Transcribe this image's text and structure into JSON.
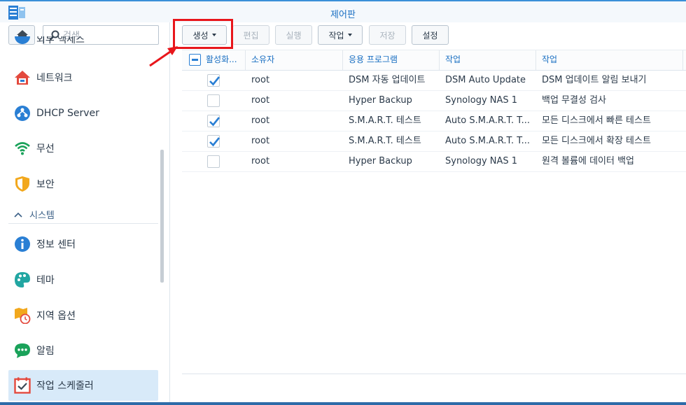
{
  "window": {
    "title": "제어판"
  },
  "colors": {
    "accent": "#1a6fc2",
    "highlight": "#e8161b",
    "active_bg": "#d8eaf9"
  },
  "sidebar": {
    "search_placeholder": "검색",
    "partial_item": "외부 액세스",
    "items": [
      {
        "label": "네트워크",
        "icon": "network-house-icon"
      },
      {
        "label": "DHCP Server",
        "icon": "dhcp-server-icon"
      },
      {
        "label": "무선",
        "icon": "wifi-icon"
      },
      {
        "label": "보안",
        "icon": "shield-icon"
      }
    ],
    "section": {
      "label": "시스템",
      "icon": "chevron-up-icon"
    },
    "system_items": [
      {
        "label": "정보 센터",
        "icon": "info-icon"
      },
      {
        "label": "테마",
        "icon": "palette-icon"
      },
      {
        "label": "지역 옵션",
        "icon": "map-clock-icon"
      },
      {
        "label": "알림",
        "icon": "chat-bubble-icon"
      },
      {
        "label": "작업 스케줄러",
        "icon": "calendar-check-icon",
        "active": true
      }
    ]
  },
  "toolbar": {
    "create": "생성",
    "edit": "편집",
    "run": "실행",
    "action": "작업",
    "save": "저장",
    "settings": "설정"
  },
  "table": {
    "columns": [
      "활성화...",
      "소유자",
      "응용 프로그램",
      "작업",
      "작업"
    ],
    "rows": [
      {
        "enabled": true,
        "owner": "root",
        "app": "DSM 자동 업데이트",
        "task": "DSM Auto Update",
        "action": "DSM 업데이트 알림 보내기"
      },
      {
        "enabled": false,
        "owner": "root",
        "app": "Hyper Backup",
        "task": "Synology NAS 1",
        "action": "백업 무결성 검사"
      },
      {
        "enabled": true,
        "owner": "root",
        "app": "S.M.A.R.T. 테스트",
        "task": "Auto S.M.A.R.T. T...",
        "action": "모든 디스크에서 빠른 테스트"
      },
      {
        "enabled": true,
        "owner": "root",
        "app": "S.M.A.R.T. 테스트",
        "task": "Auto S.M.A.R.T. T...",
        "action": "모든 디스크에서 확장 테스트"
      },
      {
        "enabled": false,
        "owner": "root",
        "app": "Hyper Backup",
        "task": "Synology NAS 1",
        "action": "원격 볼륨에 데이터 백업"
      }
    ]
  }
}
